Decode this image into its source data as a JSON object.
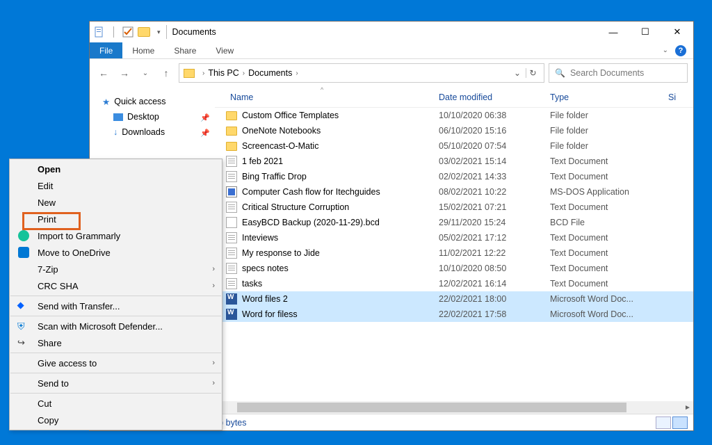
{
  "window": {
    "title": "Documents"
  },
  "ribbon": {
    "tabs": {
      "file": "File",
      "home": "Home",
      "share": "Share",
      "view": "View"
    }
  },
  "address": {
    "root": "This PC",
    "folder": "Documents"
  },
  "search": {
    "placeholder": "Search Documents"
  },
  "tree": {
    "quick_access": "Quick access",
    "desktop": "Desktop",
    "downloads": "Downloads"
  },
  "columns": {
    "name": "Name",
    "date": "Date modified",
    "type": "Type",
    "size": "Si"
  },
  "rows": [
    {
      "icon": "folder",
      "name": "Custom Office Templates",
      "date": "10/10/2020 06:38",
      "type": "File folder"
    },
    {
      "icon": "folder",
      "name": "OneNote Notebooks",
      "date": "06/10/2020 15:16",
      "type": "File folder"
    },
    {
      "icon": "folder",
      "name": "Screencast-O-Matic",
      "date": "05/10/2020 07:54",
      "type": "File folder"
    },
    {
      "icon": "text",
      "name": "1 feb 2021",
      "date": "03/02/2021 15:14",
      "type": "Text Document"
    },
    {
      "icon": "text",
      "name": "Bing Traffic Drop",
      "date": "02/02/2021 14:33",
      "type": "Text Document"
    },
    {
      "icon": "app",
      "name": "Computer Cash flow for Itechguides",
      "date": "08/02/2021 10:22",
      "type": "MS-DOS Application"
    },
    {
      "icon": "text",
      "name": "Critical Structure Corruption",
      "date": "15/02/2021 07:21",
      "type": "Text Document"
    },
    {
      "icon": "bcd",
      "name": "EasyBCD Backup (2020-11-29).bcd",
      "date": "29/11/2020 15:24",
      "type": "BCD File"
    },
    {
      "icon": "text",
      "name": "Inteviews",
      "date": "05/02/2021 17:12",
      "type": "Text Document"
    },
    {
      "icon": "text",
      "name": "My response to Jide",
      "date": "11/02/2021 12:22",
      "type": "Text Document"
    },
    {
      "icon": "text",
      "name": "specs notes",
      "date": "10/10/2020 08:50",
      "type": "Text Document"
    },
    {
      "icon": "text",
      "name": "tasks",
      "date": "12/02/2021 16:14",
      "type": "Text Document"
    },
    {
      "icon": "word",
      "name": "Word files 2",
      "date": "22/02/2021 18:00",
      "type": "Microsoft Word Doc...",
      "sel": true
    },
    {
      "icon": "word",
      "name": "Word for filess",
      "date": "22/02/2021 17:58",
      "type": "Microsoft Word Doc...",
      "sel": true
    }
  ],
  "status": {
    "text": ") bytes"
  },
  "ctx": {
    "open": "Open",
    "edit": "Edit",
    "new": "New",
    "print": "Print",
    "grammarly": "Import to Grammarly",
    "onedrive": "Move to OneDrive",
    "zip": "7-Zip",
    "crc": "CRC SHA",
    "transfer": "Send with Transfer...",
    "defender": "Scan with Microsoft Defender...",
    "share": "Share",
    "give_access": "Give access to",
    "send_to": "Send to",
    "cut": "Cut",
    "copy": "Copy"
  }
}
